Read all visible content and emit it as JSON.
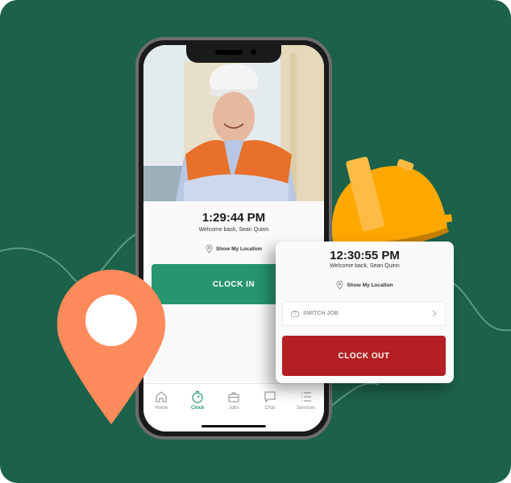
{
  "colors": {
    "background": "#1c614a",
    "clock_in": "#279670",
    "clock_out": "#b31f22",
    "pin": "#ff8a5b",
    "hardhat": "#ffa800"
  },
  "phone": {
    "time": "1:29:44 PM",
    "welcome": "Welcome back, Sean Quinn",
    "location_label": "Show My Location",
    "location_icon": "map-pin-icon",
    "clock_in_label": "CLOCK IN",
    "tabs": [
      {
        "label": "Home",
        "icon": "home-icon",
        "active": false
      },
      {
        "label": "Clock",
        "icon": "stopwatch-icon",
        "active": true
      },
      {
        "label": "Jobs",
        "icon": "briefcase-icon",
        "active": false
      },
      {
        "label": "Chat",
        "icon": "chat-icon",
        "active": false
      },
      {
        "label": "Services",
        "icon": "list-icon",
        "active": false
      }
    ]
  },
  "card": {
    "time": "12:30:55 PM",
    "welcome": "Welcome back, Sean Quinn",
    "location_label": "Show My Location",
    "switch_job_label": "SWITCH JOB",
    "clock_out_label": "CLOCK OUT"
  }
}
